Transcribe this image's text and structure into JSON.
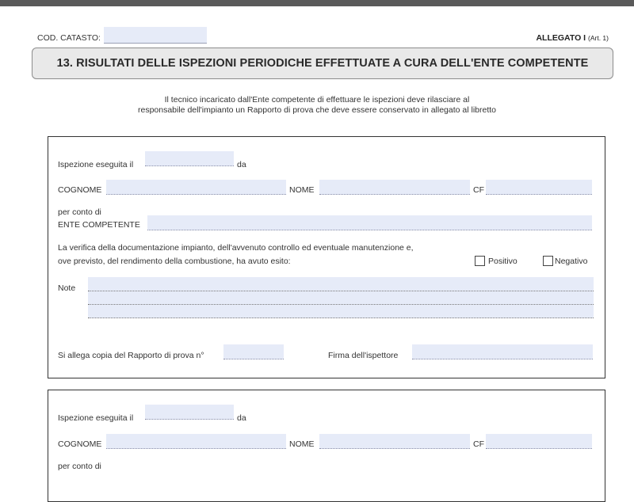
{
  "header": {
    "cod_catasto_label": "COD. CATASTO:",
    "allegato_label": "ALLEGATO I",
    "allegato_ref": "(Art. 1)"
  },
  "title": "13. RISULTATI DELLE ISPEZIONI PERIODICHE EFFETTUATE A CURA DELL'ENTE COMPETENTE",
  "intro": {
    "line1": "Il tecnico incaricato dall'Ente competente di effettuare le ispezioni deve rilasciare al",
    "line2": "responsabile dell'impianto un Rapporto di prova che deve essere conservato in allegato al libretto"
  },
  "form": {
    "ispezione_label": "Ispezione eseguita il",
    "da_label": "da",
    "cognome_label": "COGNOME",
    "nome_label": "NOME",
    "cf_label": "CF",
    "per_conto_label": "per conto di",
    "ente_label": "ENTE COMPETENTE",
    "verifica_line1": "La verifica della documentazione impianto, dell'avvenuto controllo ed eventuale manutenzione e,",
    "verifica_line2": "ove previsto, del rendimento della combustione, ha avuto esito:",
    "positivo_label": "Positivo",
    "negativo_label": "Negativo",
    "note_label": "Note",
    "allega_label": "Si allega copia del Rapporto di prova n°",
    "firma_label": "Firma dell'ispettore"
  }
}
